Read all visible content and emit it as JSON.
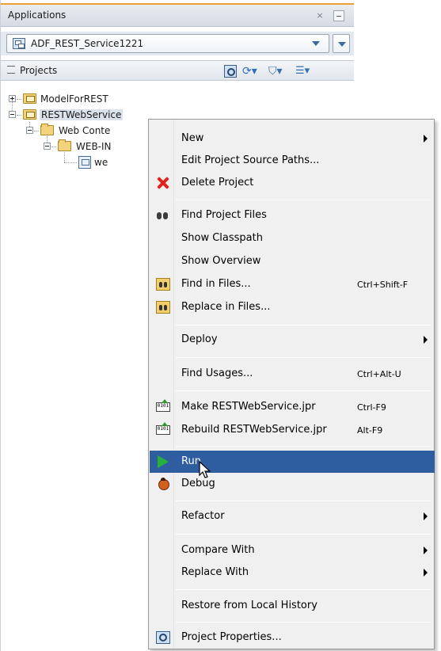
{
  "applications_panel": {
    "title": "Applications",
    "close_icon": "close-icon",
    "minimize_icon": "minimize-icon"
  },
  "app_selector": {
    "selected": "ADF_REST_Service1221"
  },
  "projects_panel": {
    "title": "Projects"
  },
  "tree": {
    "items": [
      {
        "label": "ModelForREST"
      },
      {
        "label": "RESTWebService"
      },
      {
        "label": "Web Conte"
      },
      {
        "label": "WEB-IN"
      },
      {
        "label": "we"
      }
    ]
  },
  "context_menu": {
    "items": [
      {
        "label": "New",
        "has_submenu": true
      },
      {
        "label": "Edit Project Source Paths..."
      },
      {
        "label": "Delete Project",
        "icon": "delete-icon"
      },
      {
        "label": "Find Project Files",
        "icon": "binoculars-icon"
      },
      {
        "label": "Show Classpath"
      },
      {
        "label": "Show Overview"
      },
      {
        "label": "Find in Files...",
        "shortcut": "Ctrl+Shift-F",
        "icon": "find-in-files-icon"
      },
      {
        "label": "Replace in Files...",
        "icon": "replace-in-files-icon"
      },
      {
        "label": "Deploy",
        "has_submenu": true
      },
      {
        "label": "Find Usages...",
        "shortcut": "Ctrl+Alt-U"
      },
      {
        "label": "Make RESTWebService.jpr",
        "shortcut": "Ctrl-F9",
        "icon": "make-icon"
      },
      {
        "label": "Rebuild RESTWebService.jpr",
        "shortcut": "Alt-F9",
        "icon": "rebuild-icon"
      },
      {
        "label": "Run",
        "icon": "run-icon",
        "highlighted": true
      },
      {
        "label": "Debug",
        "icon": "debug-icon"
      },
      {
        "label": "Refactor",
        "has_submenu": true
      },
      {
        "label": "Compare With",
        "has_submenu": true
      },
      {
        "label": "Replace With",
        "has_submenu": true
      },
      {
        "label": "Restore from Local History"
      },
      {
        "label": "Project Properties...",
        "icon": "project-properties-icon"
      }
    ]
  },
  "colors": {
    "menu_highlight": "#2e5ea0",
    "header_accent": "#f0a030",
    "menu_background": "#f0f0f0"
  }
}
